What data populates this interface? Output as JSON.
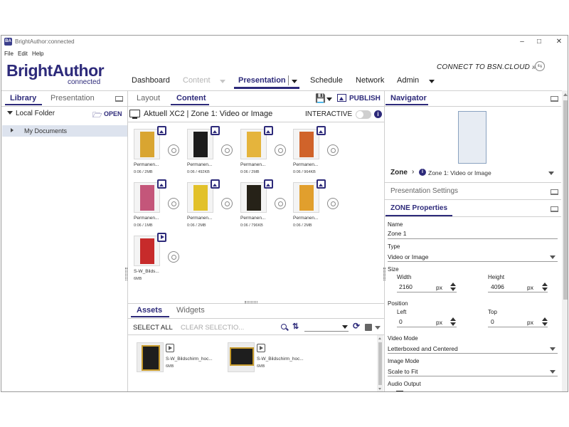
{
  "window": {
    "title": "BrightAuthor:connected",
    "app_icon": "BA"
  },
  "menu": [
    "File",
    "Edit",
    "Help"
  ],
  "logo": {
    "main": "BrightAuthor",
    "sub": "connected"
  },
  "nav": {
    "dashboard": "Dashboard",
    "content": "Content",
    "presentation": "Presentation",
    "schedule": "Schedule",
    "network": "Network",
    "admin": "Admin"
  },
  "connect_label": "CONNECT TO BSN.CLOUD »",
  "left_panel": {
    "tabs": [
      "Library",
      "Presentation"
    ],
    "folder_label": "Local Folder",
    "open_label": "OPEN",
    "items": [
      "My Documents"
    ]
  },
  "center_panel": {
    "tabs": [
      "Layout",
      "Content"
    ],
    "publish_label": "PUBLISH",
    "zone_title": "Aktuell XC2 | Zone 1: Video or Image",
    "interactive_label": "INTERACTIVE",
    "thumbnails": [
      {
        "name": "Permanen...",
        "meta": "0:06 / 2MB",
        "badge": "image",
        "color": "#d9a531"
      },
      {
        "name": "Permanen...",
        "meta": "0:06 / 492KB",
        "badge": "image",
        "color": "#1c1c1c"
      },
      {
        "name": "Permanen...",
        "meta": "0:06 / 2MB",
        "badge": "image",
        "color": "#e5b43c"
      },
      {
        "name": "Permanen...",
        "meta": "0:06 / 964KB",
        "badge": "image",
        "color": "#d0632a"
      },
      {
        "name": "Permanen...",
        "meta": "0:06 / 1MB",
        "badge": "image",
        "color": "#c4567a"
      },
      {
        "name": "Permanen...",
        "meta": "0:06 / 2MB",
        "badge": "image",
        "color": "#e2c12a"
      },
      {
        "name": "Permanen...",
        "meta": "0:06 / 796KB",
        "badge": "image",
        "color": "#262218"
      },
      {
        "name": "Permanen...",
        "meta": "0:06 / 2MB",
        "badge": "image",
        "color": "#e19f2d"
      },
      {
        "name": "S-W_Bilds...",
        "meta": "6MB",
        "badge": "video",
        "color": "#c72b2b"
      }
    ]
  },
  "assets_panel": {
    "tabs": [
      "Assets",
      "Widgets"
    ],
    "select_all": "SELECT ALL",
    "clear_selection": "CLEAR SELECTIO...",
    "items": [
      {
        "name": "S-W_Bildschirm_hoc...",
        "meta": "6MB"
      },
      {
        "name": "S-W_Bildschirm_hoc...",
        "meta": "6MB"
      }
    ]
  },
  "right_panel": {
    "navigator_label": "Navigator",
    "zone_label": "Zone",
    "zone_value": "Zone 1: Video or Image",
    "presentation_settings": "Presentation Settings",
    "zone_properties": "ZONE Properties",
    "name_label": "Name",
    "name_value": "Zone 1",
    "type_label": "Type",
    "type_value": "Video or Image",
    "size_label": "Size",
    "width_label": "Width",
    "width_value": "2160",
    "height_label": "Height",
    "height_value": "4096",
    "unit": "px",
    "position_label": "Position",
    "left_label": "Left",
    "left_value": "0",
    "top_label": "Top",
    "top_value": "0",
    "video_mode_label": "Video Mode",
    "video_mode_value": "Letterboxed and Centered",
    "image_mode_label": "Image Mode",
    "image_mode_value": "Scale to Fit",
    "audio_output_label": "Audio Output"
  },
  "colors": {
    "accent": "#2d2a7a",
    "selection": "#dde3ee"
  }
}
